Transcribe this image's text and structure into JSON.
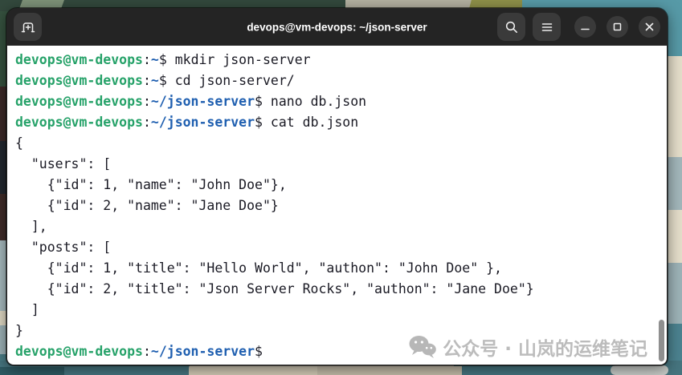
{
  "titlebar": {
    "title": "devops@vm-devops: ~/json-server"
  },
  "icons": {
    "new_tab": "new-tab-icon",
    "search": "search-icon",
    "menu": "menu-icon",
    "minimize": "minimize-icon",
    "maximize": "maximize-icon",
    "close": "close-icon",
    "watermark": "wechat-icon"
  },
  "colors": {
    "titlebar_bg": "#242424",
    "titlebar_button_bg": "#3a3a3a",
    "title_fg": "#ffffff",
    "terminal_bg": "#ffffff",
    "terminal_fg": "#1a1a24",
    "prompt_green": "#26a269",
    "path_blue": "#1f5fb0",
    "scrollbar_gray": "#8f8f8f",
    "watermark_gray": "#bcbcbc"
  },
  "terminal": {
    "lines": [
      {
        "segments": [
          {
            "text": "devops@vm-devops",
            "color": "green"
          },
          {
            "text": ":",
            "color": "fg"
          },
          {
            "text": "~",
            "color": "blue"
          },
          {
            "text": "$ ",
            "color": "fg"
          },
          {
            "text": "mkdir json-server",
            "color": "fg"
          }
        ]
      },
      {
        "segments": [
          {
            "text": "devops@vm-devops",
            "color": "green"
          },
          {
            "text": ":",
            "color": "fg"
          },
          {
            "text": "~",
            "color": "blue"
          },
          {
            "text": "$ ",
            "color": "fg"
          },
          {
            "text": "cd json-server/",
            "color": "fg"
          }
        ]
      },
      {
        "segments": [
          {
            "text": "devops@vm-devops",
            "color": "green"
          },
          {
            "text": ":",
            "color": "fg"
          },
          {
            "text": "~/json-server",
            "color": "blue"
          },
          {
            "text": "$ ",
            "color": "fg"
          },
          {
            "text": "nano db.json",
            "color": "fg"
          }
        ]
      },
      {
        "segments": [
          {
            "text": "devops@vm-devops",
            "color": "green"
          },
          {
            "text": ":",
            "color": "fg"
          },
          {
            "text": "~/json-server",
            "color": "blue"
          },
          {
            "text": "$ ",
            "color": "fg"
          },
          {
            "text": "cat db.json",
            "color": "fg"
          }
        ]
      },
      {
        "segments": [
          {
            "text": "{",
            "color": "fg"
          }
        ]
      },
      {
        "segments": [
          {
            "text": "  \"users\": [",
            "color": "fg"
          }
        ]
      },
      {
        "segments": [
          {
            "text": "    {\"id\": 1, \"name\": \"John Doe\"},",
            "color": "fg"
          }
        ]
      },
      {
        "segments": [
          {
            "text": "    {\"id\": 2, \"name\": \"Jane Doe\"}",
            "color": "fg"
          }
        ]
      },
      {
        "segments": [
          {
            "text": "  ],",
            "color": "fg"
          }
        ]
      },
      {
        "segments": [
          {
            "text": "  \"posts\": [",
            "color": "fg"
          }
        ]
      },
      {
        "segments": [
          {
            "text": "    {\"id\": 1, \"title\": \"Hello World\", \"authon\": \"John Doe\" },",
            "color": "fg"
          }
        ]
      },
      {
        "segments": [
          {
            "text": "    {\"id\": 2, \"title\": \"Json Server Rocks\", \"authon\": \"Jane Doe\"}",
            "color": "fg"
          }
        ]
      },
      {
        "segments": [
          {
            "text": "  ]",
            "color": "fg"
          }
        ]
      },
      {
        "segments": [
          {
            "text": "}",
            "color": "fg"
          }
        ]
      },
      {
        "segments": [
          {
            "text": "devops@vm-devops",
            "color": "green"
          },
          {
            "text": ":",
            "color": "fg"
          },
          {
            "text": "~/json-server",
            "color": "blue"
          },
          {
            "text": "$ ",
            "color": "fg"
          }
        ]
      }
    ]
  },
  "watermark": {
    "text": "公众号 · 山岚的运维笔记"
  }
}
